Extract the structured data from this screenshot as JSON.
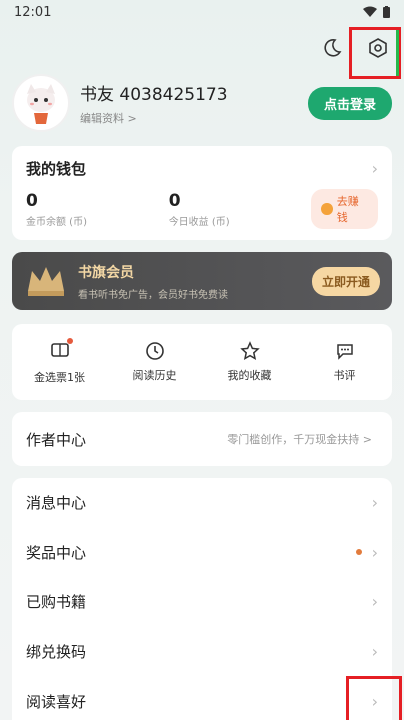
{
  "status_bar": {
    "time": "12:01"
  },
  "top_icons": {
    "night_mode": "moon-icon",
    "settings": "gear-icon"
  },
  "profile": {
    "username": "书友 4038425173",
    "edit_label": "编辑资料 >",
    "login_label": "点击登录"
  },
  "wallet": {
    "title": "我的钱包",
    "coins_value": "0",
    "coins_label": "金币余额 (币)",
    "today_value": "0",
    "today_label": "今日收益 (币)",
    "earn_label": "去赚钱"
  },
  "vip": {
    "title": "书旗会员",
    "subtitle": "看书听书免广告，会员好书免费读",
    "button": "立即开通"
  },
  "shortcuts": [
    {
      "label": "金选票1张",
      "icon": "ticket-icon"
    },
    {
      "label": "阅读历史",
      "icon": "clock-icon"
    },
    {
      "label": "我的收藏",
      "icon": "star-icon"
    },
    {
      "label": "书评",
      "icon": "comment-icon"
    }
  ],
  "author": {
    "title": "作者中心",
    "subtitle": "零门槛创作，千万现金扶持 >"
  },
  "menu": [
    {
      "label": "消息中心"
    },
    {
      "label": "奖品中心"
    },
    {
      "label": "已购书籍"
    },
    {
      "label": "绑兑换码"
    },
    {
      "label": "阅读喜好"
    }
  ],
  "colors": {
    "accent_green": "#1ea86f",
    "vip_gold": "#f3d7a5",
    "highlight": "#e51f24"
  }
}
